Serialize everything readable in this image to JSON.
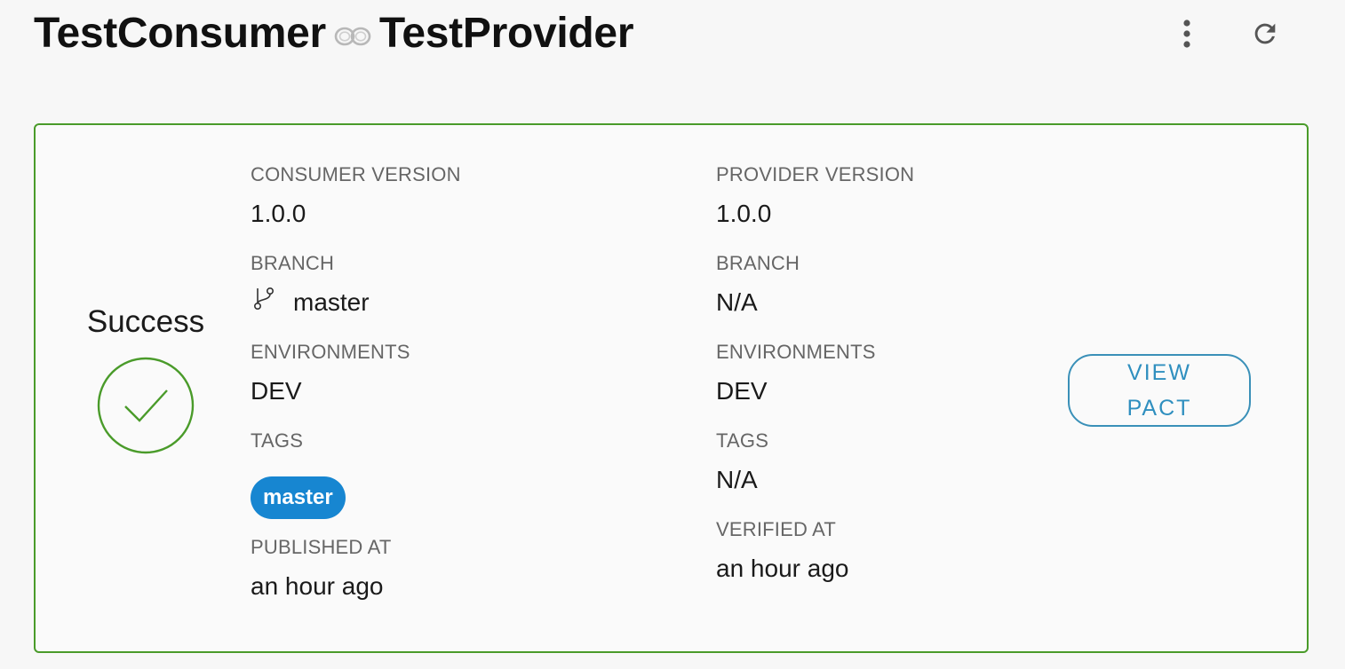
{
  "header": {
    "consumer": "TestConsumer",
    "provider": "TestProvider",
    "link_icon": "infinity-link-icon",
    "menu_icon": "more-vertical-icon",
    "refresh_icon": "refresh-icon"
  },
  "card": {
    "status": "Success",
    "status_icon": "check-circle-icon",
    "border_color": "#4a9b2a",
    "consumer": {
      "version_label": "CONSUMER VERSION",
      "version": "1.0.0",
      "branch_label": "BRANCH",
      "branch": "master",
      "branch_icon": "git-branch-icon",
      "environments_label": "ENVIRONMENTS",
      "environments": "DEV",
      "tags_label": "TAGS",
      "tag": "master",
      "published_label": "PUBLISHED AT",
      "published": "an hour ago"
    },
    "provider": {
      "version_label": "PROVIDER VERSION",
      "version": "1.0.0",
      "branch_label": "BRANCH",
      "branch": "N/A",
      "environments_label": "ENVIRONMENTS",
      "environments": "DEV",
      "tags_label": "TAGS",
      "tags": "N/A",
      "verified_label": "VERIFIED AT",
      "verified": "an hour ago"
    },
    "view_pact_label": "VIEW PACT",
    "tag_color": "#1786d1",
    "button_color": "#2f8fbf"
  }
}
